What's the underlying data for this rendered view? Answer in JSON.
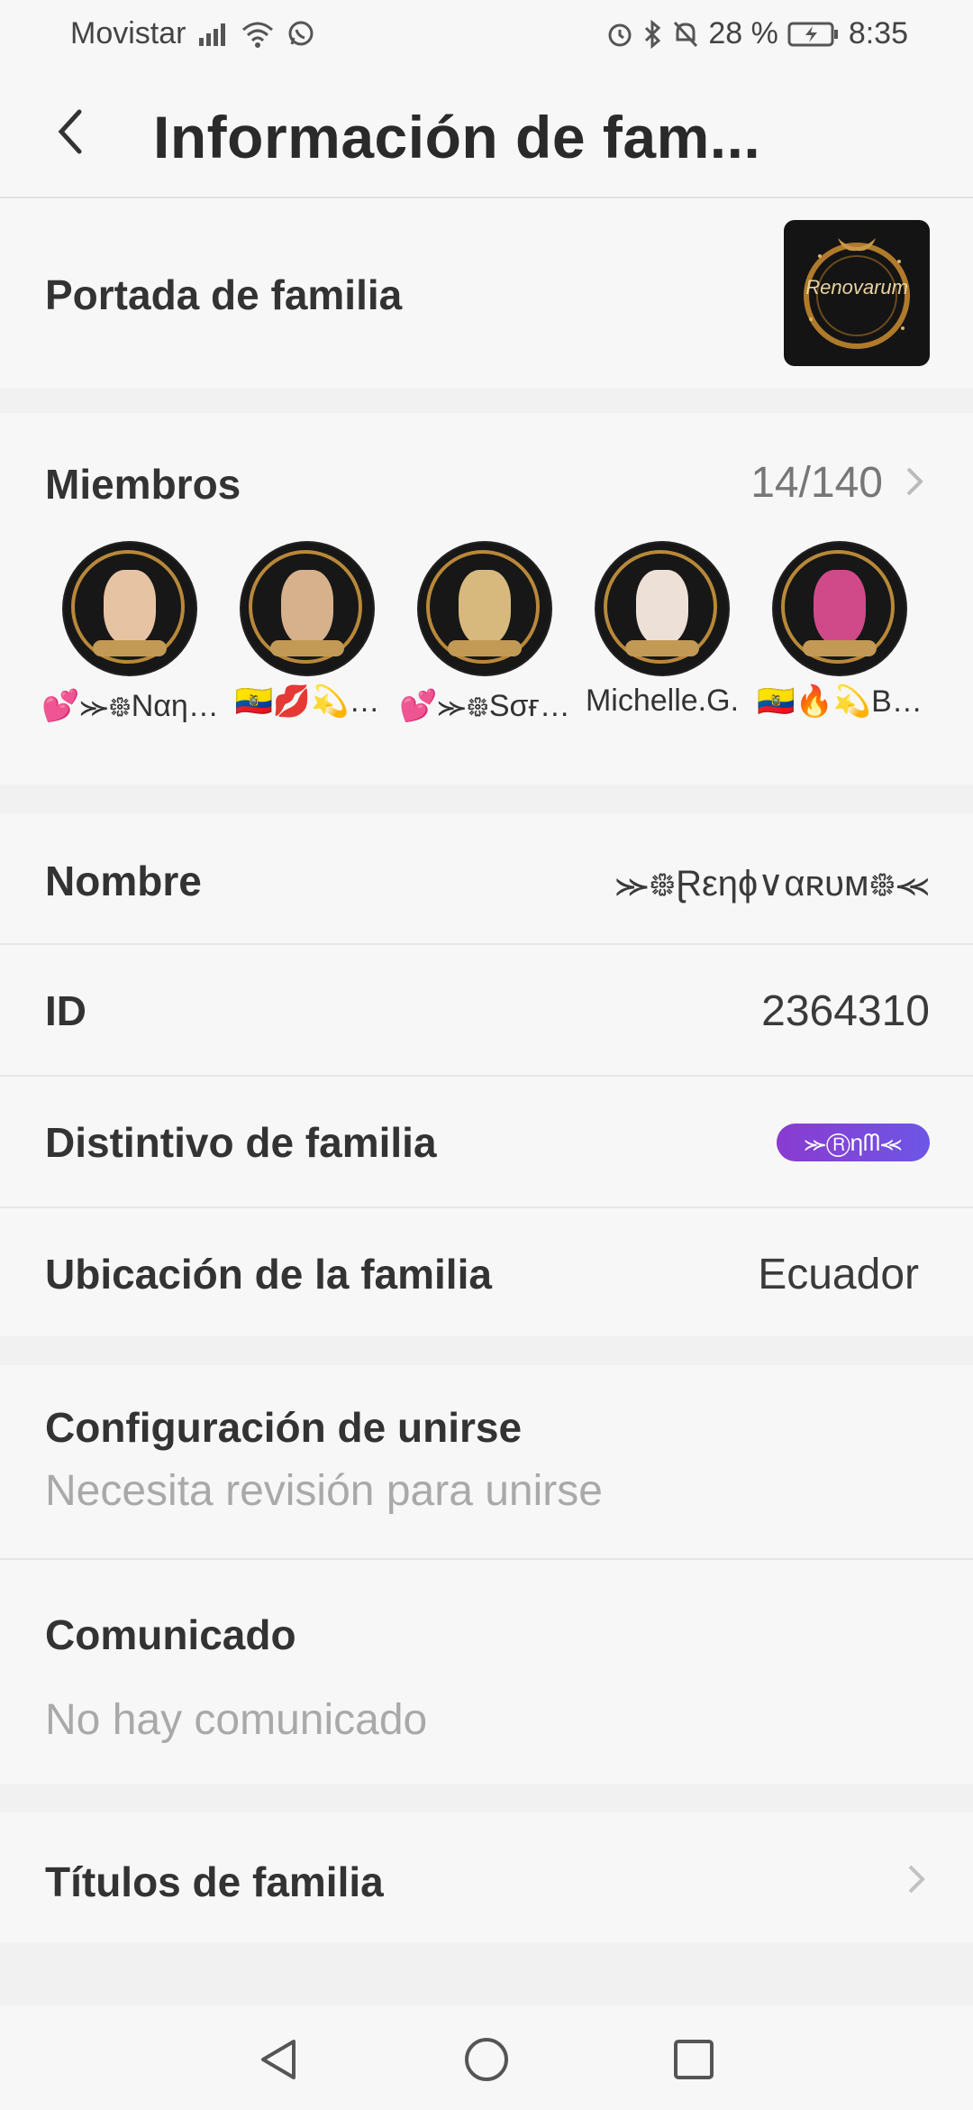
{
  "status": {
    "carrier": "Movistar",
    "battery": "28 %",
    "time": "8:35",
    "icons": [
      "signal-icon",
      "wifi-icon",
      "whatsapp-icon",
      "alarm-icon",
      "bluetooth-icon",
      "mute-icon",
      "battery-icon"
    ]
  },
  "header": {
    "title": "Información de fam..."
  },
  "cover": {
    "label": "Portada de familia",
    "image_text": "Renovarum"
  },
  "members": {
    "label": "Miembros",
    "count": "14/140",
    "items": [
      {
        "name": "💕⪼᪥Nαη…",
        "face": "#e6c4a3"
      },
      {
        "name": "🇪🇨💋💫…",
        "face": "#d7b18c"
      },
      {
        "name": "💕⪼᪥Sσғ…",
        "face": "#d8b97d"
      },
      {
        "name": "Michelle.G.",
        "face": "#ede0d6"
      },
      {
        "name": "🇪🇨🔥💫B…",
        "face": "#d04a8a"
      }
    ]
  },
  "details": {
    "name_label": "Nombre",
    "name_value": "⪼᪥Ɽεηɸ∨αʀυм᪥⪻",
    "id_label": "ID",
    "id_value": "2364310",
    "badge_label": "Distintivo de familia",
    "badge_value": "⪼Ⓡηᗰ⪻",
    "location_label": "Ubicación de la familia",
    "location_value": "Ecuador"
  },
  "join": {
    "label": "Configuración de unirse",
    "value": "Necesita revisión para unirse"
  },
  "announcement": {
    "label": "Comunicado",
    "value": "No hay comunicado"
  },
  "titles": {
    "label": "Títulos de familia"
  },
  "colors": {
    "background": "#f1f1f1",
    "card": "#f7f7f7",
    "badge": "#7b49db"
  }
}
